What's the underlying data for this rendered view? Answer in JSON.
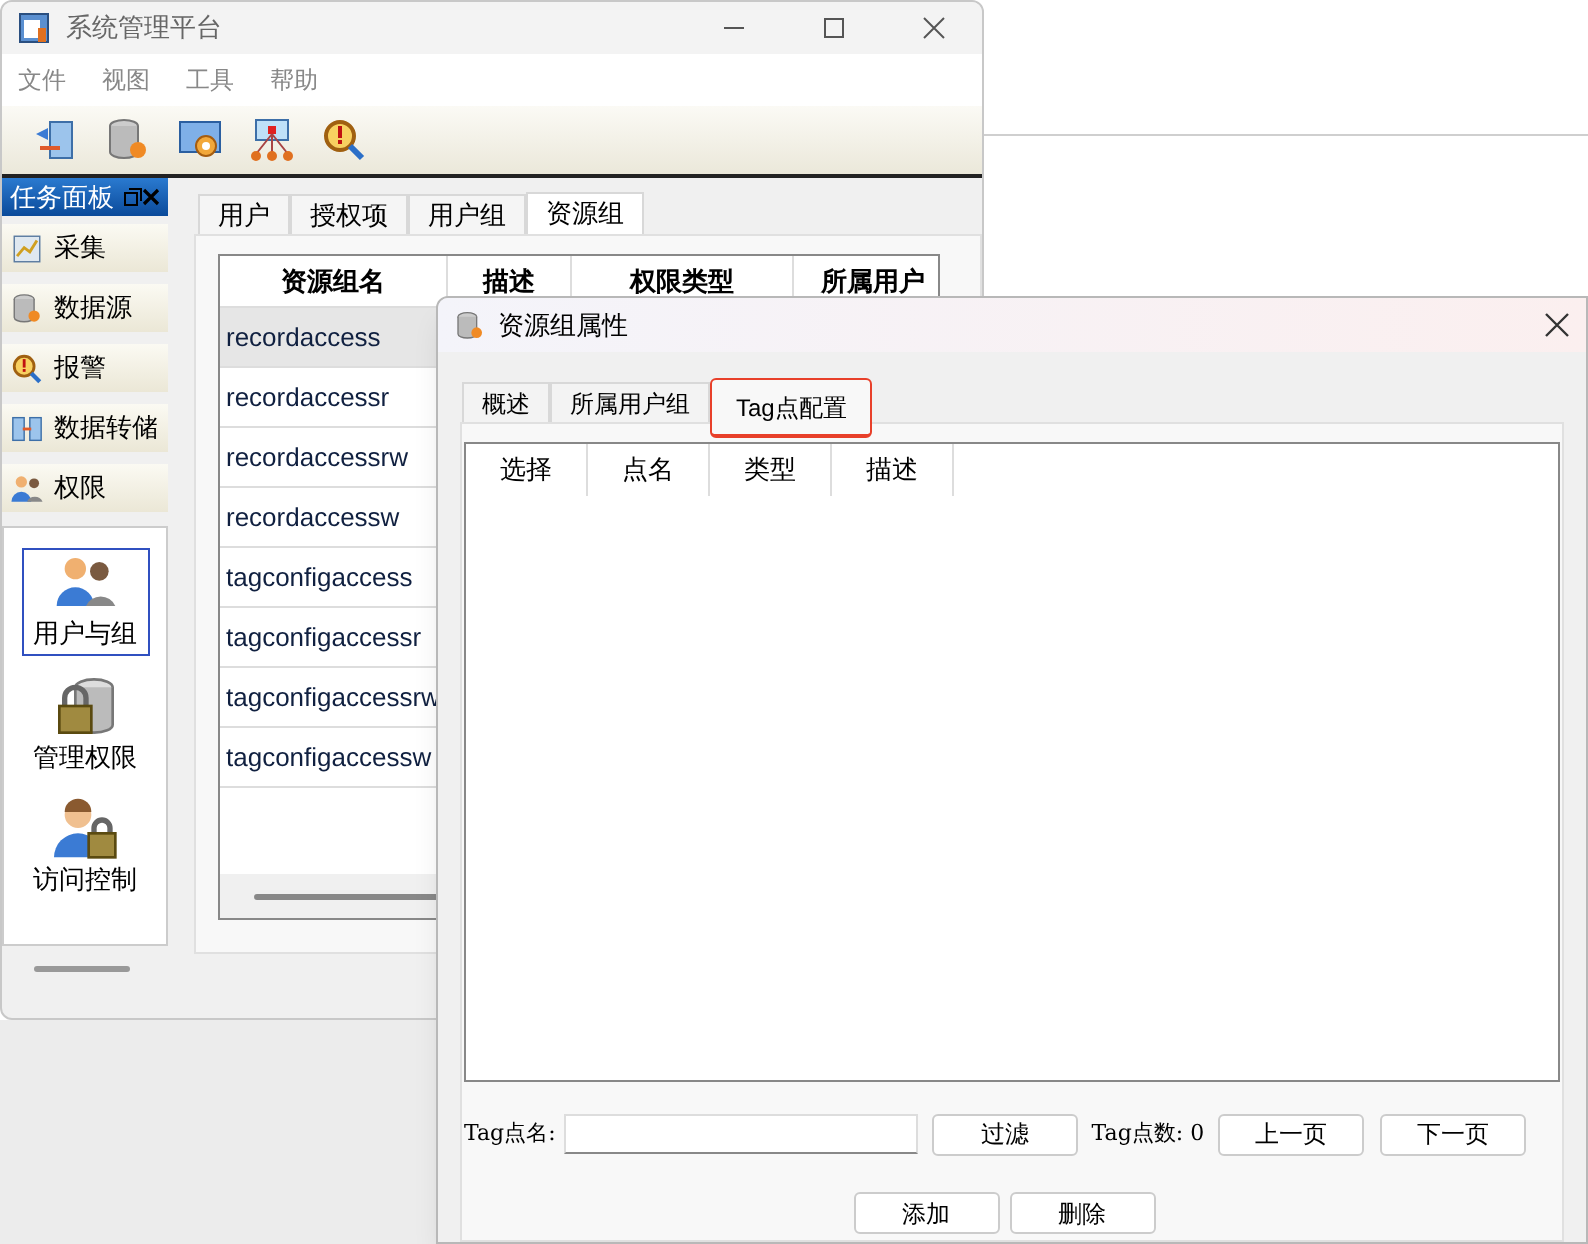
{
  "main_window": {
    "title": "系统管理平台",
    "menu": [
      "文件",
      "视图",
      "工具",
      "帮助"
    ],
    "toolbar": [
      {
        "kind": "import"
      },
      {
        "kind": "database"
      },
      {
        "kind": "settings"
      },
      {
        "kind": "network"
      },
      {
        "kind": "alarm"
      }
    ],
    "task_panel": {
      "title": "任务面板",
      "categories": [
        {
          "label": "采集",
          "kind": "collect"
        },
        {
          "label": "数据源",
          "kind": "database"
        },
        {
          "label": "报警",
          "kind": "alarm"
        },
        {
          "label": "数据转储",
          "kind": "transfer"
        },
        {
          "label": "权限",
          "kind": "users"
        }
      ],
      "items": [
        {
          "label": "用户与组",
          "kind": "users",
          "selected": true
        },
        {
          "label": "管理权限",
          "kind": "lockdb",
          "selected": false
        },
        {
          "label": "访问控制",
          "kind": "lockuser",
          "selected": false
        }
      ]
    },
    "tabs": [
      {
        "label": "用户",
        "selected": false
      },
      {
        "label": "授权项",
        "selected": false
      },
      {
        "label": "用户组",
        "selected": false
      },
      {
        "label": "资源组",
        "selected": true
      }
    ],
    "table": {
      "columns": [
        "资源组名",
        "描述",
        "权限类型",
        "所属用户"
      ],
      "rows": [
        {
          "name": "recordaccess",
          "selected": true
        },
        {
          "name": "recordaccessr",
          "selected": false
        },
        {
          "name": "recordaccessrw",
          "selected": false
        },
        {
          "name": "recordaccessw",
          "selected": false
        },
        {
          "name": "tagconfigaccess",
          "selected": false
        },
        {
          "name": "tagconfigaccessr",
          "selected": false
        },
        {
          "name": "tagconfigaccessrw",
          "selected": false
        },
        {
          "name": "tagconfigaccessw",
          "selected": false
        }
      ]
    }
  },
  "dialog": {
    "title": "资源组属性",
    "tabs": [
      {
        "label": "概述",
        "selected": false,
        "highlighted": false
      },
      {
        "label": "所属用户组",
        "selected": false,
        "highlighted": false
      },
      {
        "label": "Tag点配置",
        "selected": true,
        "highlighted": true
      }
    ],
    "list_columns": [
      "选择",
      "点名",
      "类型",
      "描述"
    ],
    "tag_name_label": "Tag点名:",
    "filter_button": "过滤",
    "tag_count": "Tag点数: 0",
    "prev_button": "上一页",
    "next_button": "下一页",
    "add_button": "添加",
    "delete_button": "删除"
  }
}
